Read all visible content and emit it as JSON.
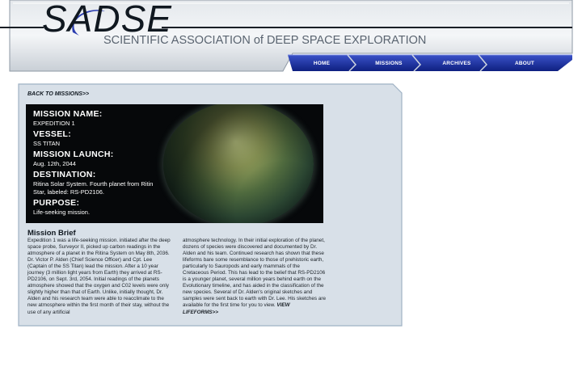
{
  "header": {
    "logo_text": "SADSE",
    "org_name": "SCIENTIFIC ASSOCIATION of DEEP SPACE EXPLORATION",
    "nav": [
      {
        "label": "HOME"
      },
      {
        "label": "MISSIONS"
      },
      {
        "label": "ARCHIVES"
      },
      {
        "label": "ABOUT"
      }
    ]
  },
  "main": {
    "back_link": "BACK TO MISSIONS>>",
    "mission": {
      "name_label": "MISSION NAME:",
      "name_value": "EXPEDITION 1",
      "vessel_label": "VESSEL:",
      "vessel_value": "SS TITAN",
      "launch_label": "MISSION LAUNCH:",
      "launch_value": "Aug. 12th, 2044",
      "destination_label": "DESTINATION:",
      "destination_value": "Ritina Solar System. Fourth planet from Ritin Star, labeled: RS-PD2106.",
      "purpose_label": "PURPOSE:",
      "purpose_value": "Life-seeking mission."
    },
    "brief_title": "Mission Brief",
    "brief_col1": "Expedition 1 was a life-seeking mission. initiated after the deep space probe, Surveyor II, picked up carbon readings in the atmosphere of a planet in the Ritina System on May 8th, 2036. Dr. Victor P. Alden (Chief Science Officer) and Cpt. Lee (Captain of the SS Titan) lead the mission. After a 10 year journey (3 million light years from Earth) they arrived at RS-PD2106, on Sept. 3rd, 2054. Initial readings of the planets atmosphere showed that the oxygen and C02 levels were only slightly higher than that of Earth. Unlike, initially thought, Dr. Alden and his research team were able to reacclimate to the new atmosphere within the first month of their stay, without the use of any artificial",
    "brief_col2": "atmosphere technology. In their initial exploration of the planet, dozens of species were discovered and documented by Dr. Alden and his team. Continued research has shown that these lifeforms bare some resemblance to those of prehistoric earth, particularly to Sauropods and early mammals of the Cretaceous Period. This has lead to the belief that RS-PD2106 is a younger planet, several million years behind earth on the Evolutionary timeline, and has aided in the classification of the new species. Several of Dr. Alden's original sketches and samples were sent back to earth with Dr. Lee. His sketches are available for the first time for you to view.",
    "view_link": "VIEW LIFEFORMS>>"
  },
  "colors": {
    "nav_blue": "#1a2f9c",
    "panel_fill": "#d8e0e8",
    "panel_border": "#9fb2c4",
    "header_gray": "#cdd3da",
    "logo_swoosh": "#2a3db0"
  }
}
